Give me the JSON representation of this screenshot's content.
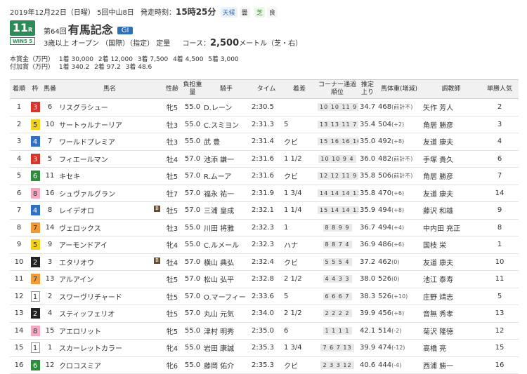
{
  "header": {
    "date_line": "2019年12月22日（日曜） 5回中山8日",
    "start_label": "発走時刻：",
    "start_time": "15時25分",
    "weather_label": "天候",
    "weather": "曇",
    "turf_label": "芝",
    "turf_condition": "良",
    "race_number": "11",
    "race_number_suffix": "R",
    "wins_label": "WIN5 5",
    "edition": "第64回",
    "race_name": "有馬記念",
    "grade": "GI",
    "conditions": "3歳以上 オープン （国際）（指定） 定量",
    "course_label": "コース：",
    "distance": "2,500",
    "course_suffix": "メートル（芝・右）"
  },
  "prize": {
    "main_label": "本賞金（万円）",
    "main": [
      "1着 30,000",
      "2着 12,000",
      "3着 7,500",
      "4着 4,500",
      "5着 3,000"
    ],
    "extra_label": "付加賞（万円）",
    "extra": [
      "1着 340.2",
      "2着 97.2",
      "3着 48.6"
    ]
  },
  "columns": [
    "着順",
    "枠",
    "馬番",
    "馬名",
    "性齢",
    "負担重量",
    "騎手",
    "タイム",
    "着差",
    "コーナー通過順位",
    "推定上り",
    "馬体重(増減)",
    "調教師",
    "単勝人気"
  ],
  "rows": [
    {
      "pos": "1",
      "waku": "3",
      "num": "6",
      "horse": "リスグラシュー",
      "blinker": "",
      "sexage": "牝5",
      "weight": "55.0",
      "jockey": "D.レーン",
      "time": "2:30.5",
      "margin": "",
      "corner": "10 10 11 9",
      "last3f": "34.7",
      "body": "468",
      "delta": "(前計不)",
      "trainer": "矢作 芳人",
      "pop": "2"
    },
    {
      "pos": "2",
      "waku": "5",
      "num": "10",
      "horse": "サートゥルナーリア",
      "blinker": "",
      "sexage": "牡3",
      "weight": "55.0",
      "jockey": "C.スミヨン",
      "time": "2:31.3",
      "margin": "5",
      "corner": "13 13 11 7",
      "last3f": "35.4",
      "body": "504",
      "delta": "(+2)",
      "trainer": "角居 勝彦",
      "pop": "3"
    },
    {
      "pos": "3",
      "waku": "4",
      "num": "7",
      "horse": "ワールドプレミア",
      "blinker": "",
      "sexage": "牡3",
      "weight": "55.0",
      "jockey": "武 豊",
      "time": "2:31.4",
      "margin": "クビ",
      "corner": "15 16 16 16",
      "last3f": "35.0",
      "body": "492",
      "delta": "(+8)",
      "trainer": "友道 康夫",
      "pop": "4"
    },
    {
      "pos": "4",
      "waku": "3",
      "num": "5",
      "horse": "フィエールマン",
      "blinker": "",
      "sexage": "牡4",
      "weight": "57.0",
      "jockey": "池添 謙一",
      "time": "2:31.6",
      "margin": "1 1/2",
      "corner": "10 10 9 4",
      "last3f": "36.0",
      "body": "482",
      "delta": "(前計不)",
      "trainer": "手塚 貴久",
      "pop": "6"
    },
    {
      "pos": "5",
      "waku": "6",
      "num": "11",
      "horse": "キセキ",
      "blinker": "",
      "sexage": "牡5",
      "weight": "57.0",
      "jockey": "R.ムーア",
      "time": "2:31.6",
      "margin": "クビ",
      "corner": "12 12 11 9",
      "last3f": "35.8",
      "body": "506",
      "delta": "(前計不)",
      "trainer": "角居 勝彦",
      "pop": "7"
    },
    {
      "pos": "6",
      "waku": "8",
      "num": "16",
      "horse": "シュヴァルグラン",
      "blinker": "",
      "sexage": "牡7",
      "weight": "57.0",
      "jockey": "福永 祐一",
      "time": "2:31.9",
      "margin": "1 3/4",
      "corner": "14 14 14 13",
      "last3f": "35.8",
      "body": "470",
      "delta": "(+6)",
      "trainer": "友道 康夫",
      "pop": "14"
    },
    {
      "pos": "7",
      "waku": "4",
      "num": "8",
      "horse": "レイデオロ",
      "blinker": "B",
      "sexage": "牡5",
      "weight": "57.0",
      "jockey": "三浦 皇成",
      "time": "2:32.1",
      "margin": "1 1/4",
      "corner": "15 14 14 13",
      "last3f": "35.9",
      "body": "494",
      "delta": "(+8)",
      "trainer": "藤沢 和雄",
      "pop": "9"
    },
    {
      "pos": "8",
      "waku": "7",
      "num": "14",
      "horse": "ヴェロックス",
      "blinker": "",
      "sexage": "牡3",
      "weight": "55.0",
      "jockey": "川田 将雅",
      "time": "2:32.3",
      "margin": "1",
      "corner": "8 8 9 9",
      "last3f": "36.7",
      "body": "494",
      "delta": "(+4)",
      "trainer": "中内田 充正",
      "pop": "8"
    },
    {
      "pos": "9",
      "waku": "5",
      "num": "9",
      "horse": "アーモンドアイ",
      "blinker": "",
      "sexage": "牝4",
      "weight": "55.0",
      "jockey": "C.ルメール",
      "time": "2:32.3",
      "margin": "ハナ",
      "corner": "8 8 7 4",
      "last3f": "36.9",
      "body": "486",
      "delta": "(+6)",
      "trainer": "国枝 栄",
      "pop": "1"
    },
    {
      "pos": "10",
      "waku": "2",
      "num": "3",
      "horse": "エタリオウ",
      "blinker": "B",
      "sexage": "牡4",
      "weight": "57.0",
      "jockey": "横山 典弘",
      "time": "2:32.4",
      "margin": "クビ",
      "corner": "5 5 5 4",
      "last3f": "37.2",
      "body": "462",
      "delta": "(0)",
      "trainer": "友道 康夫",
      "pop": "10"
    },
    {
      "pos": "11",
      "waku": "7",
      "num": "13",
      "horse": "アルアイン",
      "blinker": "",
      "sexage": "牡5",
      "weight": "57.0",
      "jockey": "松山 弘平",
      "time": "2:32.8",
      "margin": "2 1/2",
      "corner": "4 4 3 3",
      "last3f": "38.0",
      "body": "526",
      "delta": "(0)",
      "trainer": "池江 泰寿",
      "pop": "11"
    },
    {
      "pos": "12",
      "waku": "1",
      "num": "2",
      "horse": "スワーヴリチャード",
      "blinker": "",
      "sexage": "牡5",
      "weight": "57.0",
      "jockey": "O.マーフィー",
      "time": "2:33.6",
      "margin": "5",
      "corner": "6 6 6 7",
      "last3f": "38.3",
      "body": "526",
      "delta": "(+10)",
      "trainer": "庄野 靖志",
      "pop": "5"
    },
    {
      "pos": "13",
      "waku": "2",
      "num": "4",
      "horse": "スティッフェリオ",
      "blinker": "",
      "sexage": "牡5",
      "weight": "57.0",
      "jockey": "丸山 元気",
      "time": "2:34.0",
      "margin": "2 1/2",
      "corner": "2 2 2 2",
      "last3f": "39.9",
      "body": "456",
      "delta": "(+8)",
      "trainer": "音無 秀孝",
      "pop": "13"
    },
    {
      "pos": "14",
      "waku": "8",
      "num": "15",
      "horse": "アエロリット",
      "blinker": "",
      "sexage": "牝5",
      "weight": "55.0",
      "jockey": "津村 明秀",
      "time": "2:35.0",
      "margin": "6",
      "corner": "1 1 1 1",
      "last3f": "42.1",
      "body": "514",
      "delta": "(-2)",
      "trainer": "菊沢 隆徳",
      "pop": "12"
    },
    {
      "pos": "15",
      "waku": "1",
      "num": "1",
      "horse": "スカーレットカラー",
      "blinker": "",
      "sexage": "牝4",
      "weight": "55.0",
      "jockey": "岩田 康誠",
      "time": "2:35.3",
      "margin": "1 3/4",
      "corner": "7 6 7 13",
      "last3f": "39.9",
      "body": "474",
      "delta": "(-12)",
      "trainer": "高橋 亮",
      "pop": "15"
    },
    {
      "pos": "16",
      "waku": "6",
      "num": "12",
      "horse": "クロコスミア",
      "blinker": "",
      "sexage": "牝6",
      "weight": "55.0",
      "jockey": "藤岡 佑介",
      "time": "2:35.3",
      "margin": "クビ",
      "corner": "2 3 3 12",
      "last3f": "40.6",
      "body": "444",
      "delta": "(-4)",
      "trainer": "西浦 勝一",
      "pop": "16"
    }
  ],
  "waku_colors": {
    "1": {
      "bg": "#ffffff",
      "fg": "#333333",
      "border": "#999999"
    },
    "2": {
      "bg": "#222222",
      "fg": "#ffffff",
      "border": "#222222"
    },
    "3": {
      "bg": "#d9342b",
      "fg": "#ffffff",
      "border": "#d9342b"
    },
    "4": {
      "bg": "#2f6fc4",
      "fg": "#ffffff",
      "border": "#2f6fc4"
    },
    "5": {
      "bg": "#f2d21c",
      "fg": "#333333",
      "border": "#f2d21c"
    },
    "6": {
      "bg": "#2e8b3a",
      "fg": "#ffffff",
      "border": "#2e8b3a"
    },
    "7": {
      "bg": "#f19a38",
      "fg": "#333333",
      "border": "#f19a38"
    },
    "8": {
      "bg": "#f4a9c0",
      "fg": "#333333",
      "border": "#f4a9c0"
    }
  }
}
